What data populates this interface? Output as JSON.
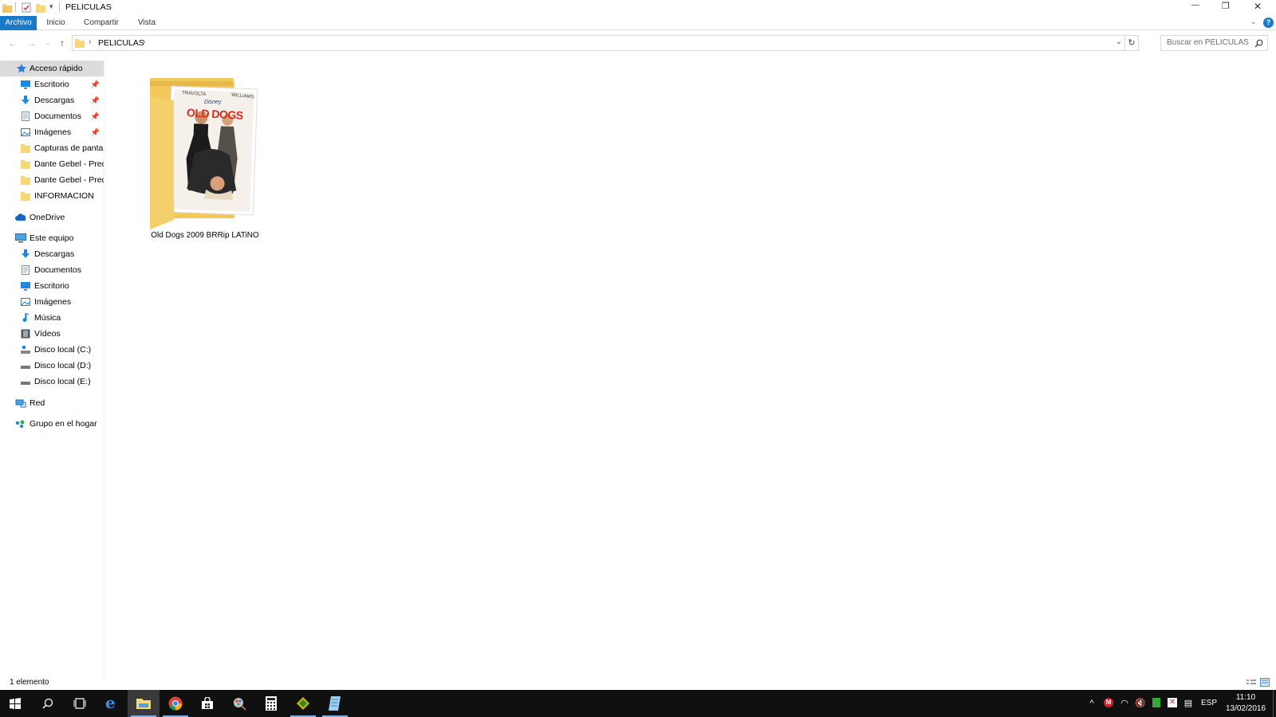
{
  "window": {
    "title": "PELICULAS",
    "minimize_glyph": "—",
    "restore_glyph": "❐",
    "close_glyph": "✕"
  },
  "ribbon": {
    "tabs": [
      {
        "label": "Archivo",
        "active": true
      },
      {
        "label": "Inicio",
        "active": false
      },
      {
        "label": "Compartir",
        "active": false
      },
      {
        "label": "Vista",
        "active": false
      }
    ],
    "help_glyph": "?"
  },
  "address": {
    "path": "PELICULAS",
    "search_placeholder": "Buscar en PELICULAS"
  },
  "sidebar": {
    "quick_access": {
      "label": "Acceso rápido",
      "icon": "star-pin-icon"
    },
    "quick_items": [
      {
        "label": "Escritorio",
        "icon": "desktop-icon",
        "pinned": true
      },
      {
        "label": "Descargas",
        "icon": "download-icon",
        "pinned": true
      },
      {
        "label": "Documentos",
        "icon": "document-icon",
        "pinned": true
      },
      {
        "label": "Imágenes",
        "icon": "pictures-icon",
        "pinned": true
      },
      {
        "label": "Capturas de pantalla",
        "icon": "folder-icon",
        "pinned": false
      },
      {
        "label": "Dante Gebel - Predicas",
        "icon": "folder-icon",
        "pinned": false
      },
      {
        "label": "Dante Gebel - Predicas",
        "icon": "folder-icon",
        "pinned": false
      },
      {
        "label": "INFORMACION",
        "icon": "folder-icon",
        "pinned": false
      }
    ],
    "onedrive": {
      "label": "OneDrive",
      "icon": "cloud-icon"
    },
    "this_pc": {
      "label": "Este equipo",
      "icon": "computer-icon"
    },
    "pc_items": [
      {
        "label": "Descargas",
        "icon": "download-icon"
      },
      {
        "label": "Documentos",
        "icon": "document-icon"
      },
      {
        "label": "Escritorio",
        "icon": "desktop-icon"
      },
      {
        "label": "Imágenes",
        "icon": "pictures-icon"
      },
      {
        "label": "Música",
        "icon": "music-icon"
      },
      {
        "label": "Vídeos",
        "icon": "video-icon"
      },
      {
        "label": "Disco local (C:)",
        "icon": "drive-c-icon"
      },
      {
        "label": "Disco local (D:)",
        "icon": "drive-icon"
      },
      {
        "label": "Disco local (E:)",
        "icon": "drive-icon"
      }
    ],
    "network": {
      "label": "Red",
      "icon": "network-icon"
    },
    "homegroup": {
      "label": "Grupo en el hogar",
      "icon": "homegroup-icon"
    }
  },
  "content": {
    "items": [
      {
        "name": "Old Dogs 2009 BRRip LATiNO",
        "poster": {
          "brand": "Disney",
          "actor_left": "TRAVOLTA",
          "actor_right": "WILLIAMS",
          "title": "OLD DOGS"
        }
      }
    ]
  },
  "status": {
    "count": "1 elemento"
  },
  "taskbar": {
    "language": "ESP",
    "time": "11:10",
    "date": "13/02/2016"
  },
  "colors": {
    "accent": "#1979ca",
    "folder": "#f8d775",
    "folder_dark": "#e8b94a",
    "poster_red": "#d9271b",
    "taskbar": "#101010"
  }
}
